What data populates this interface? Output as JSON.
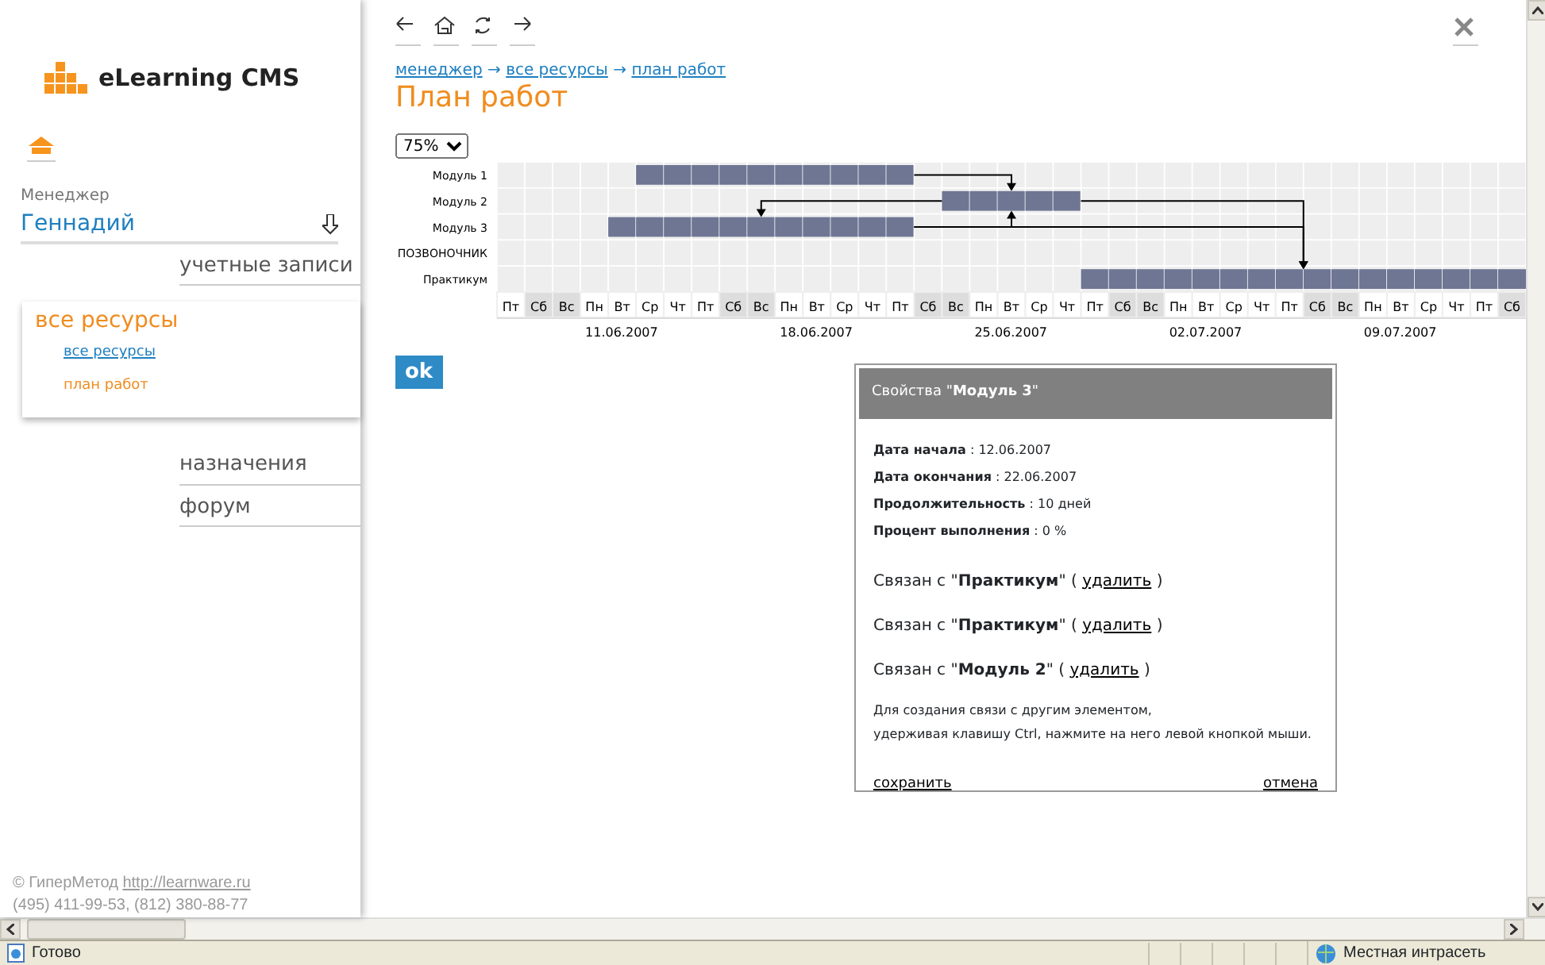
{
  "sidebar": {
    "logo": "eLearning CMS",
    "role_label": "Менеджер",
    "user": "Геннадий",
    "menu": [
      {
        "label": "учетные записи",
        "selected": false
      },
      {
        "label": "все ресурсы",
        "selected": true,
        "children": [
          {
            "label": "все ресурсы",
            "selected": false
          },
          {
            "label": "план работ",
            "selected": true
          }
        ]
      },
      {
        "label": "назначения",
        "selected": false
      },
      {
        "label": "форум",
        "selected": false
      }
    ],
    "footer": {
      "copyright": "© ГиперМетод",
      "link": "http://learnware.ru",
      "phones": "(495) 411-99-53, (812) 380-88-77"
    }
  },
  "breadcrumb": [
    "менеджер",
    "все ресурсы",
    "план работ"
  ],
  "breadcrumb_separator": "→",
  "title": "План работ",
  "zoom": "75%",
  "gantt": {
    "tasks": [
      {
        "name": "Модуль 1",
        "schedule": [
          false,
          false,
          false,
          false,
          false,
          true,
          true,
          true,
          true,
          true,
          true,
          true,
          true,
          true,
          true,
          false,
          false,
          false,
          false,
          false,
          false,
          false,
          false,
          false,
          false,
          false,
          false,
          false,
          false,
          false,
          false,
          false,
          false,
          false,
          false,
          false,
          false
        ],
        "links_to": [
          false,
          true,
          false,
          false,
          false
        ]
      },
      {
        "name": "Модуль 2",
        "schedule": [
          false,
          false,
          false,
          false,
          false,
          false,
          false,
          false,
          false,
          false,
          false,
          false,
          false,
          false,
          false,
          false,
          true,
          true,
          true,
          true,
          true,
          false,
          false,
          false,
          false,
          false,
          false,
          false,
          false,
          false,
          false,
          false,
          false,
          false,
          false,
          false,
          false
        ],
        "links_to": [
          false,
          false,
          true,
          false,
          true
        ]
      },
      {
        "name": "Модуль 3",
        "schedule": [
          false,
          false,
          false,
          false,
          true,
          true,
          true,
          true,
          true,
          true,
          true,
          true,
          true,
          true,
          true,
          false,
          false,
          false,
          false,
          false,
          false,
          false,
          false,
          false,
          false,
          false,
          false,
          false,
          false,
          false,
          false,
          false,
          false,
          false,
          false,
          false,
          false
        ],
        "links_to": [
          false,
          true,
          false,
          false,
          true
        ]
      },
      {
        "name": "ПОЗВОНОЧНИК",
        "schedule": [
          false,
          false,
          false,
          false,
          false,
          false,
          false,
          false,
          false,
          false,
          false,
          false,
          false,
          false,
          false,
          false,
          false,
          false,
          false,
          false,
          false,
          false,
          false,
          false,
          false,
          false,
          false,
          false,
          false,
          false,
          false,
          false,
          false,
          false,
          false,
          false,
          false
        ],
        "links_to": [
          false,
          false,
          false,
          false,
          false
        ]
      },
      {
        "name": "Практикум",
        "schedule": [
          false,
          false,
          false,
          false,
          false,
          false,
          false,
          false,
          false,
          false,
          false,
          false,
          false,
          false,
          false,
          false,
          false,
          false,
          false,
          false,
          false,
          true,
          true,
          true,
          true,
          true,
          true,
          true,
          true,
          true,
          true,
          true,
          true,
          true,
          true,
          true,
          true
        ],
        "links_to": [
          false,
          false,
          false,
          false,
          false
        ]
      }
    ],
    "days": [
      {
        "label": "Пт",
        "weekend": false
      },
      {
        "label": "Сб",
        "weekend": true
      },
      {
        "label": "Вс",
        "weekend": true
      },
      {
        "label": "Пн",
        "weekend": false,
        "date": "11.06.2007"
      },
      {
        "label": "Вт",
        "weekend": false
      },
      {
        "label": "Ср",
        "weekend": false
      },
      {
        "label": "Чт",
        "weekend": false
      },
      {
        "label": "Пт",
        "weekend": false
      },
      {
        "label": "Сб",
        "weekend": true
      },
      {
        "label": "Вс",
        "weekend": true
      },
      {
        "label": "Пн",
        "weekend": false,
        "date": "18.06.2007"
      },
      {
        "label": "Вт",
        "weekend": false
      },
      {
        "label": "Ср",
        "weekend": false
      },
      {
        "label": "Чт",
        "weekend": false
      },
      {
        "label": "Пт",
        "weekend": false
      },
      {
        "label": "Сб",
        "weekend": true
      },
      {
        "label": "Вс",
        "weekend": true
      },
      {
        "label": "Пн",
        "weekend": false,
        "date": "25.06.2007"
      },
      {
        "label": "Вт",
        "weekend": false
      },
      {
        "label": "Ср",
        "weekend": false
      },
      {
        "label": "Чт",
        "weekend": false
      },
      {
        "label": "Пт",
        "weekend": false
      },
      {
        "label": "Сб",
        "weekend": true
      },
      {
        "label": "Вс",
        "weekend": true
      },
      {
        "label": "Пн",
        "weekend": false,
        "date": "02.07.2007"
      },
      {
        "label": "Вт",
        "weekend": false
      },
      {
        "label": "Ср",
        "weekend": false
      },
      {
        "label": "Чт",
        "weekend": false
      },
      {
        "label": "Пт",
        "weekend": false
      },
      {
        "label": "Сб",
        "weekend": true
      },
      {
        "label": "Вс",
        "weekend": true
      },
      {
        "label": "Пн",
        "weekend": false,
        "date": "09.07.2007"
      },
      {
        "label": "Вт",
        "weekend": false
      },
      {
        "label": "Ср",
        "weekend": false
      },
      {
        "label": "Чт",
        "weekend": false
      },
      {
        "label": "Пт",
        "weekend": false
      },
      {
        "label": "Сб",
        "weekend": true
      }
    ]
  },
  "ok_button": "ok",
  "dialog": {
    "title": "Свойства \"**Модуль 3**\"",
    "properties": [
      "**Дата начала** : 12.06.2007",
      "**Дата окончания** : 22.06.2007",
      "**Продолжительность** : 10 дней",
      "**Процент выполнения** : 0 %"
    ],
    "links": [
      {
        "text": "Связан с \"**Практикум**\" (",
        "action": "удалить",
        "after": ")"
      },
      {
        "text": "Связан с \"**Практикум**\" (",
        "action": "удалить",
        "after": ")"
      },
      {
        "text": "Связан с \"**Модуль 2**\" (",
        "action": "удалить",
        "after": ")"
      }
    ],
    "hint": [
      "Для создания связи с другим элементом,",
      "удерживая клавишу Ctrl, нажмите на него левой кнопкой мыши."
    ],
    "save": "сохранить",
    "cancel": "отмена"
  },
  "status_bar": {
    "status": "Готово",
    "zone": "Местная интрасеть"
  }
}
